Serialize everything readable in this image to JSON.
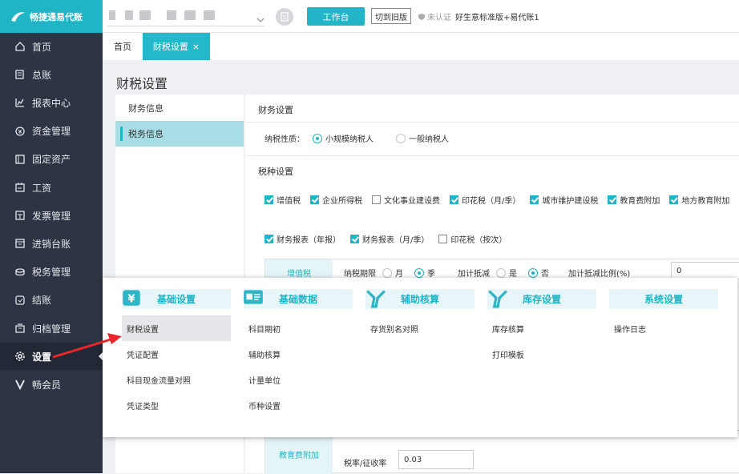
{
  "app": {
    "logo_text": "畅捷通易代账"
  },
  "colors": {
    "accent": "#1fb4c6",
    "sidebar_bg": "#2d3443",
    "arrow": "#e8262c"
  },
  "sidebar": {
    "items": [
      {
        "label": "首页",
        "icon": "home-icon"
      },
      {
        "label": "总账",
        "icon": "ledger-icon"
      },
      {
        "label": "报表中心",
        "icon": "chart-icon"
      },
      {
        "label": "资金管理",
        "icon": "money-icon"
      },
      {
        "label": "固定资产",
        "icon": "asset-icon"
      },
      {
        "label": "工资",
        "icon": "calendar-icon"
      },
      {
        "label": "发票管理",
        "icon": "invoice-icon"
      },
      {
        "label": "进销台账",
        "icon": "inventory-icon"
      },
      {
        "label": "税务管理",
        "icon": "tax-icon"
      },
      {
        "label": "结账",
        "icon": "checkout-icon"
      },
      {
        "label": "归档管理",
        "icon": "archive-icon"
      },
      {
        "label": "设置",
        "icon": "gear-icon"
      },
      {
        "label": "畅会员",
        "icon": "vip-icon"
      }
    ]
  },
  "header": {
    "work_button": "工作台",
    "old_button": "切到旧版",
    "cert_status": "未认证",
    "account_name": "好生意标准版+易代账1"
  },
  "tabs": {
    "home": "首页",
    "active": "财税设置",
    "close": "×"
  },
  "page": {
    "title": "财税设置"
  },
  "left_menu": [
    "财务信息",
    "税务信息"
  ],
  "finance": {
    "section_title": "财务设置",
    "taxpayer_label": "纳税性质：",
    "taxpayer_options": [
      "小规模纳税人",
      "一般纳税人"
    ],
    "tax_section_title": "税种设置",
    "taxes_row1": [
      {
        "label": "增值税",
        "checked": true
      },
      {
        "label": "企业所得税",
        "checked": true
      },
      {
        "label": "文化事业建设费",
        "checked": false
      },
      {
        "label": "印花税（月/季）",
        "checked": true
      },
      {
        "label": "城市维护建设税",
        "checked": true
      },
      {
        "label": "教育费附加",
        "checked": true
      },
      {
        "label": "地方教育附加",
        "checked": true
      }
    ],
    "taxes_row2": [
      {
        "label": "财务报表（年报）",
        "checked": true
      },
      {
        "label": "财务报表（月/季）",
        "checked": true
      },
      {
        "label": "印花税（按次）",
        "checked": false
      }
    ],
    "vat": {
      "label": "增值税",
      "period_label": "纳税期限",
      "period_options": [
        "月",
        "季"
      ],
      "deduct_label": "加计抵减",
      "deduct_options": [
        "是",
        "否"
      ],
      "ratio_label": "加计抵减比例(%)",
      "ratio_value": "0"
    },
    "edu": {
      "label": "教育费附加",
      "rate_label": "税率/征收率",
      "rate_value": "0.03"
    }
  },
  "popup": {
    "columns": [
      {
        "title": "基础设置",
        "icon": "yuan-settings-icon",
        "items": [
          "财税设置",
          "凭证配置",
          "科目现金流量对照",
          "凭证类型"
        ]
      },
      {
        "title": "基础数据",
        "icon": "data-card-icon",
        "items": [
          "科目期初",
          "辅助核算",
          "计量单位",
          "币种设置"
        ]
      },
      {
        "title": "辅助核算",
        "icon": "wrench-icon",
        "items": [
          "存货别名对照"
        ]
      },
      {
        "title": "库存设置",
        "icon": "wrench-icon",
        "items": [
          "库存核算",
          "打印模板"
        ]
      },
      {
        "title": "系统设置",
        "icon": "",
        "items": [
          "操作日志"
        ]
      }
    ]
  }
}
